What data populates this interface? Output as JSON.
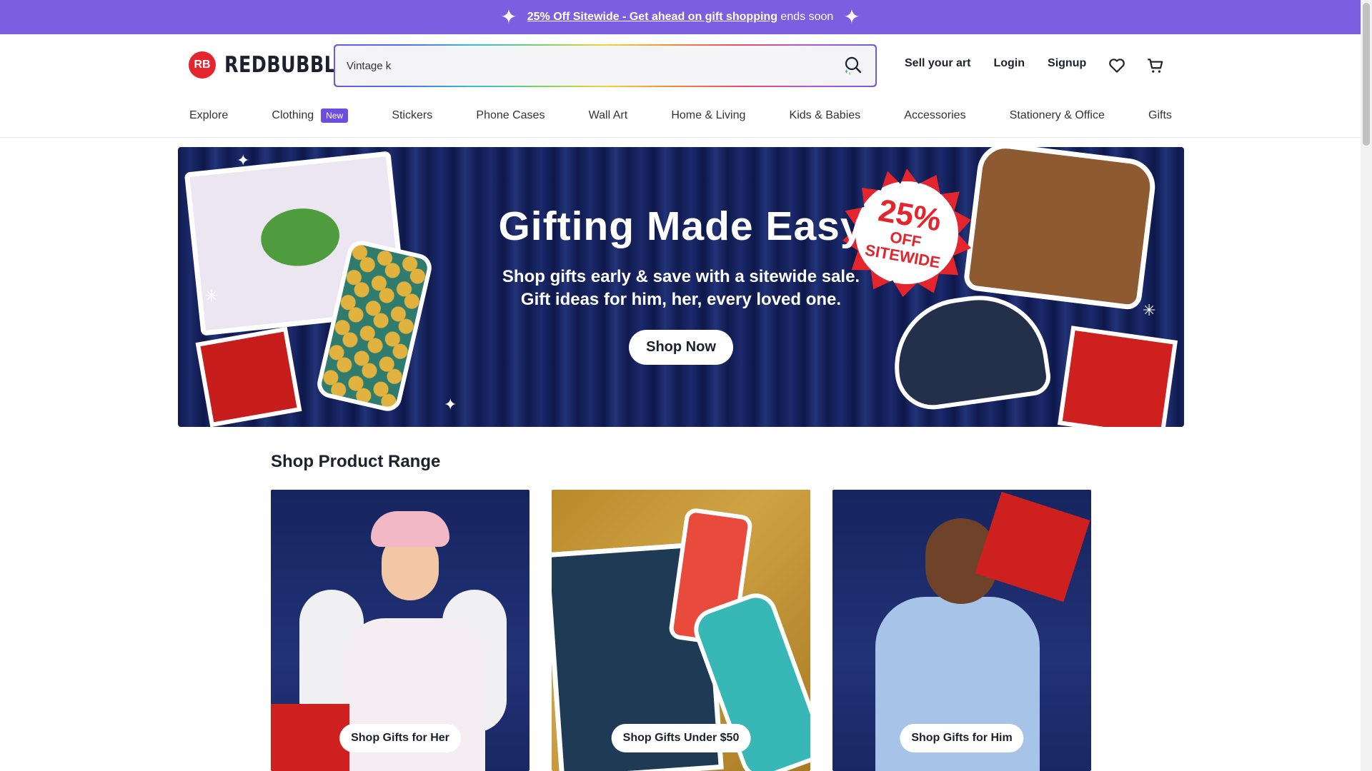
{
  "promo_bar": {
    "link_text": "25% Off Sitewide - Get ahead on gift shopping",
    "suffix": "ends soon",
    "icon": "sparkle-icon"
  },
  "header": {
    "logo_mark": "RB",
    "logo_text": "REDBUBBLE",
    "search": {
      "value": "Vintage k",
      "icon": "search-icon"
    },
    "links": [
      "Sell your art",
      "Login",
      "Signup"
    ],
    "icons": [
      "heart-icon",
      "cart-icon"
    ]
  },
  "nav": {
    "items": [
      "Explore",
      "Clothing",
      "Stickers",
      "Phone Cases",
      "Wall Art",
      "Home & Living",
      "Kids & Babies",
      "Accessories",
      "Stationery & Office",
      "Gifts"
    ],
    "clothing_badge": "New"
  },
  "hero": {
    "title": "Gifting Made Easy",
    "subtitle_line1": "Shop gifts early & save with a sitewide sale.",
    "subtitle_line2": "Gift ideas for him, her, every loved one.",
    "button": "Shop Now",
    "burst_big": "25%",
    "burst_off": "OFF",
    "burst_small": "SITEWIDE"
  },
  "product_range": {
    "title": "Shop Product Range",
    "cards": [
      {
        "button": "Shop Gifts for Her"
      },
      {
        "button": "Shop Gifts Under $50"
      },
      {
        "button": "Shop Gifts for Him"
      }
    ]
  },
  "colors": {
    "promo_bg": "#7b5fe0",
    "brand_red": "#e4252d",
    "badge": "#6d4de0",
    "hero_bg": "#1c2a6c"
  }
}
